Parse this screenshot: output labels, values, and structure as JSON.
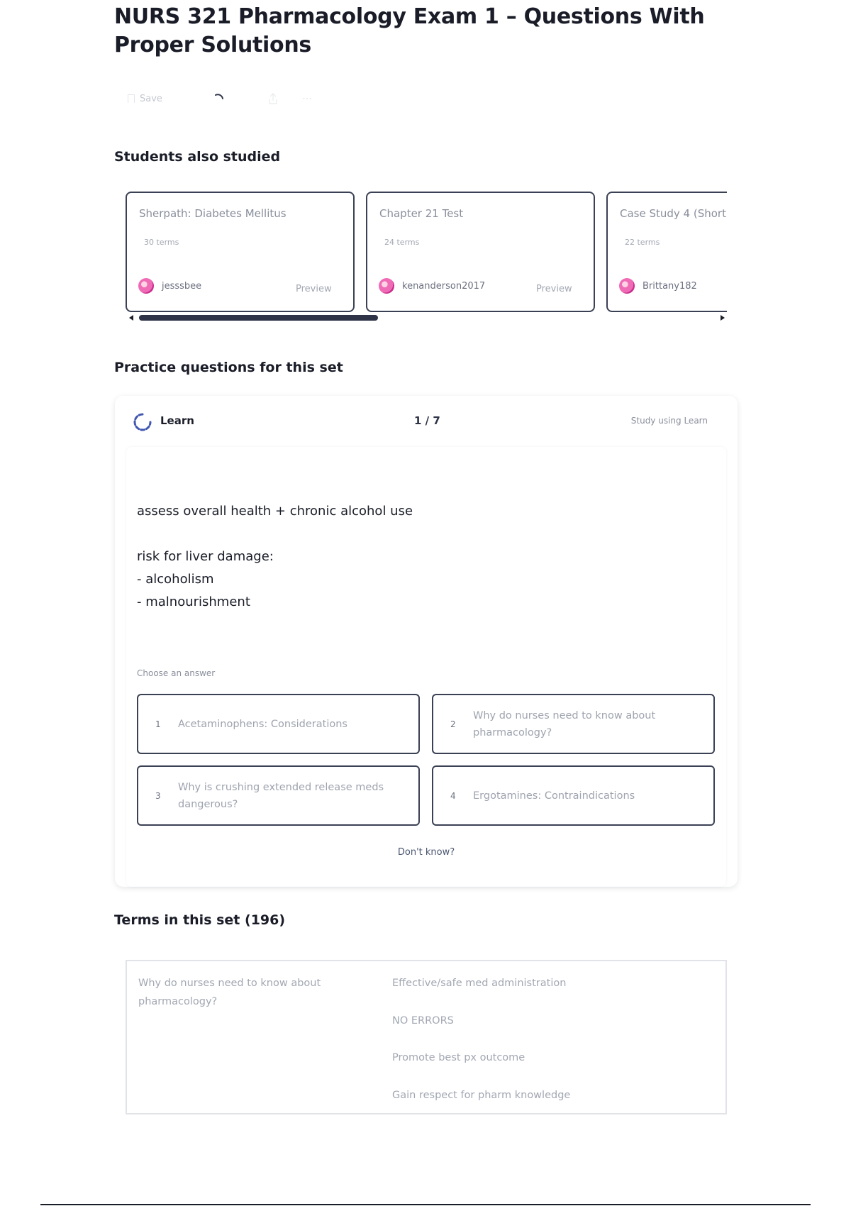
{
  "page": {
    "title": "NURS 321 Pharmacology Exam 1 – Questions With Proper Solutions"
  },
  "toolbar": {
    "save_label": "Save",
    "save_icon": "bookmark-icon",
    "loading_icon": "spinner-icon"
  },
  "students_also_studied": {
    "heading": "Students also studied",
    "cards": [
      {
        "title": "Sherpath: Diabetes Mellitus",
        "terms": "30 terms",
        "author": "jesssbee",
        "preview_label": "Preview"
      },
      {
        "title": "Chapter 21 Test",
        "terms": "24 terms",
        "author": "kenanderson2017",
        "preview_label": "Preview"
      },
      {
        "title": "Case Study 4 (Short",
        "terms": "22 terms",
        "author": "Brittany182"
      }
    ],
    "scroll_position": 0.33
  },
  "practice": {
    "heading": "Practice questions for this set",
    "learn_label": "Learn",
    "progress": "1 / 7",
    "study_link": "Study using Learn",
    "prompt": "assess overall health + chronic alcohol use\n\nrisk for liver damage:\n- alcoholism\n- malnourishment",
    "choose_label": "Choose an answer",
    "answers": [
      {
        "num": "1",
        "text": "Acetaminophens: Considerations"
      },
      {
        "num": "2",
        "text": "Why do nurses need to know about pharmacology?"
      },
      {
        "num": "3",
        "text": "Why is crushing extended release meds dangerous?"
      },
      {
        "num": "4",
        "text": "Ergotamines: Contraindications"
      }
    ],
    "dont_know": "Don't know?"
  },
  "terms": {
    "heading": "Terms in this set (196)",
    "items": [
      {
        "term": "Why do nurses need to know about pharmacology?",
        "definition": [
          "Effective/safe med administration",
          "NO ERRORS",
          "Promote best px outcome",
          "Gain respect for pharm knowledge"
        ]
      }
    ]
  },
  "colors": {
    "text": "#1a1d28",
    "border": "#3b4154",
    "muted": "#a2a7b2",
    "learn_accent": "#4257b2"
  }
}
